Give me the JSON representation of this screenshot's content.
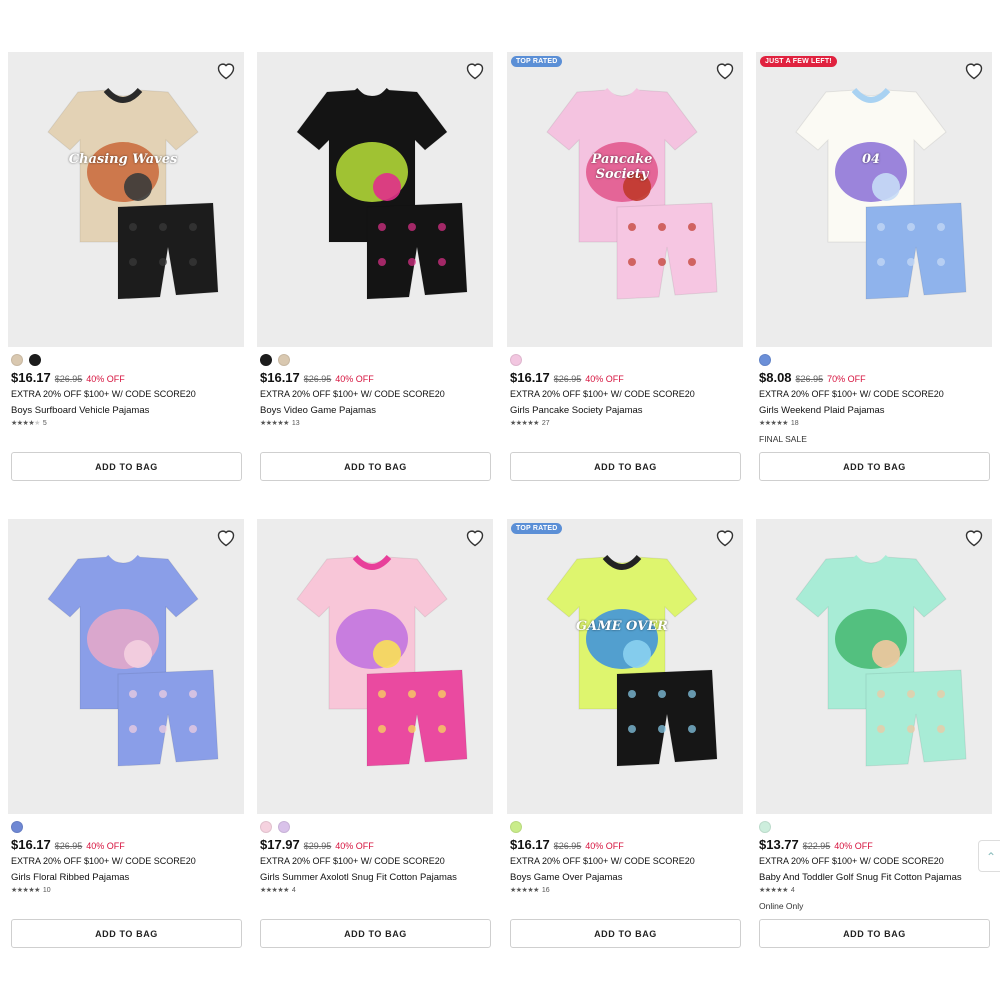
{
  "colors": {
    "top_rated_badge": "#5b8fd6",
    "few_left_badge": "#e0223f",
    "sale_red": "#d6123d",
    "image_bg": "#ececec"
  },
  "products": [
    {
      "name": "Boys Surfboard Vehicle Pajamas",
      "price": "$16.17",
      "original_price": "$26.95",
      "discount": "40% OFF",
      "promo": "EXTRA 20% OFF $100+ W/ CODE SCORE20",
      "rating_value": 3.5,
      "rating_count": "5",
      "swatches": [
        "#d9c8b0",
        "#1c1c1c"
      ],
      "badge": "",
      "note": "",
      "button": "ADD TO BAG",
      "art": {
        "shirt": "#e3d2b5",
        "collar": "#2a2a2a",
        "shorts": "#1c1c1c",
        "graphic": "#c9683a",
        "graphic2": "#3b3b3b",
        "text": "Chasing Waves"
      }
    },
    {
      "name": "Boys Video Game Pajamas",
      "price": "$16.17",
      "original_price": "$26.95",
      "discount": "40% OFF",
      "promo": "EXTRA 20% OFF $100+ W/ CODE SCORE20",
      "rating_value": 4.5,
      "rating_count": "13",
      "swatches": [
        "#1c1c1c",
        "#d9c8b0"
      ],
      "badge": "",
      "note": "",
      "button": "ADD TO BAG",
      "art": {
        "shirt": "#141414",
        "collar": "#141414",
        "shorts": "#141414",
        "graphic": "#b8e038",
        "graphic2": "#e0308a",
        "text": ""
      }
    },
    {
      "name": "Girls Pancake Society Pajamas",
      "price": "$16.17",
      "original_price": "$26.95",
      "discount": "40% OFF",
      "promo": "EXTRA 20% OFF $100+ W/ CODE SCORE20",
      "rating_value": 5,
      "rating_count": "27",
      "swatches": [
        "#f2c6e0"
      ],
      "badge": "TOP RATED",
      "note": "",
      "button": "ADD TO BAG",
      "art": {
        "shirt": "#f4c3e0",
        "collar": "#f4c3e0",
        "shorts": "#f6c6e2",
        "graphic": "#e0558a",
        "graphic2": "#c0392b",
        "text": "Pancake Society"
      }
    },
    {
      "name": "Girls Weekend Plaid Pajamas",
      "price": "$8.08",
      "original_price": "$26.95",
      "discount": "70% OFF",
      "promo": "EXTRA 20% OFF $100+ W/ CODE SCORE20",
      "rating_value": 5,
      "rating_count": "18",
      "swatches": [
        "#6b8fd8"
      ],
      "badge": "JUST A FEW LEFT!",
      "note": "FINAL SALE",
      "button": "ADD TO BAG",
      "art": {
        "shirt": "#fbfaf4",
        "collar": "#a9d2f2",
        "shorts": "#8fb3ec",
        "graphic": "#8a6fd6",
        "graphic2": "#c7dcf6",
        "text": "04"
      }
    },
    {
      "name": "Girls Floral Ribbed Pajamas",
      "price": "$16.17",
      "original_price": "$26.95",
      "discount": "40% OFF",
      "promo": "EXTRA 20% OFF $100+ W/ CODE SCORE20",
      "rating_value": 5,
      "rating_count": "10",
      "swatches": [
        "#6f88d4"
      ],
      "badge": "",
      "note": "",
      "button": "ADD TO BAG",
      "art": {
        "shirt": "#8a9ee8",
        "collar": "#8a9ee8",
        "shorts": "#8a9ee8",
        "graphic": "#e8a8c8",
        "graphic2": "#f4d0e0",
        "text": ""
      }
    },
    {
      "name": "Girls Summer Axolotl Snug Fit Cotton Pajamas",
      "price": "$17.97",
      "original_price": "$29.95",
      "discount": "40% OFF",
      "promo": "EXTRA 20% OFF $100+ W/ CODE SCORE20",
      "rating_value": 5,
      "rating_count": "4",
      "swatches": [
        "#f5d2df",
        "#d9c2ea"
      ],
      "badge": "",
      "note": "",
      "button": "ADD TO BAG",
      "art": {
        "shirt": "#f8c6d8",
        "collar": "#e83f9a",
        "shorts": "#ea4aa0",
        "graphic": "#c070e0",
        "graphic2": "#f8e058",
        "text": ""
      }
    },
    {
      "name": "Boys Game Over Pajamas",
      "price": "$16.17",
      "original_price": "$26.95",
      "discount": "40% OFF",
      "promo": "EXTRA 20% OFF $100+ W/ CODE SCORE20",
      "rating_value": 5,
      "rating_count": "16",
      "swatches": [
        "#c9ec8a"
      ],
      "badge": "TOP RATED",
      "note": "",
      "button": "ADD TO BAG",
      "art": {
        "shirt": "#def56e",
        "collar": "#222222",
        "shorts": "#161616",
        "graphic": "#3a8fe0",
        "graphic2": "#8ad0f0",
        "text": "GAME OVER"
      }
    },
    {
      "name": "Baby And Toddler Golf Snug Fit Cotton Pajamas",
      "price": "$13.77",
      "original_price": "$22.95",
      "discount": "40% OFF",
      "promo": "EXTRA 20% OFF $100+ W/ CODE SCORE20",
      "rating_value": 4.5,
      "rating_count": "4",
      "swatches": [
        "#cdeedd"
      ],
      "badge": "",
      "note": "Online Only",
      "button": "ADD TO BAG",
      "art": {
        "shirt": "#a8ecd6",
        "collar": "#a8ecd6",
        "shorts": "#a8ecd6",
        "graphic": "#44b870",
        "graphic2": "#f2c8a0",
        "text": ""
      }
    }
  ]
}
